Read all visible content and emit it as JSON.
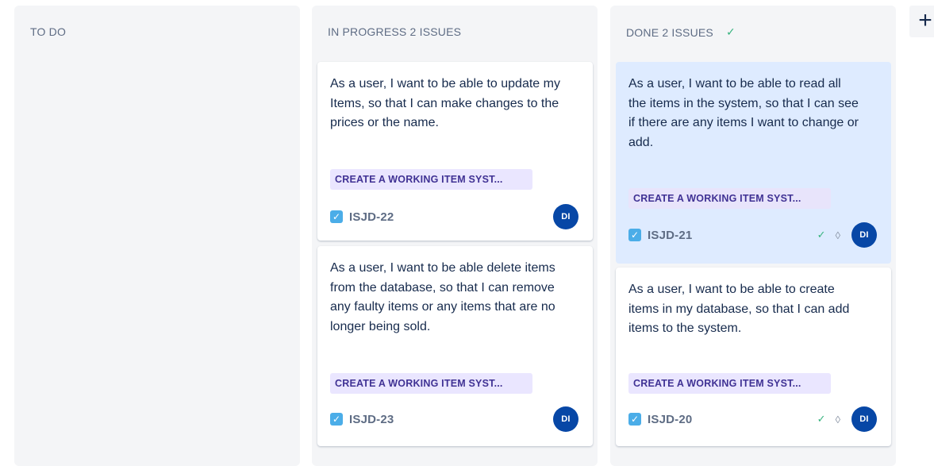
{
  "columns": {
    "todo": {
      "title": "TO DO"
    },
    "in_progress": {
      "title": "IN PROGRESS 2 ISSUES"
    },
    "done": {
      "title": "DONE 2 ISSUES"
    }
  },
  "cards": {
    "isjd22": {
      "title": "As a user, I want to be able to update my Items, so that I can make changes to the prices or the name.",
      "epic": "CREATE A WORKING ITEM SYST...",
      "key": "ISJD-22",
      "assignee": "DI"
    },
    "isjd23": {
      "title": "As a user, I want to be able delete items from the database, so that I can remove any faulty items or any items that are no longer being sold.",
      "epic": "CREATE A WORKING ITEM SYST...",
      "key": "ISJD-23",
      "assignee": "DI"
    },
    "isjd21": {
      "title": "As a user, I want to be able to read all the items in the system, so that I can see if there are any items I want to change or add.",
      "epic": "CREATE A WORKING ITEM SYST...",
      "key": "ISJD-21",
      "assignee": "DI"
    },
    "isjd20": {
      "title": "As a user, I want to be able to create items in my database, so that I can add items to the system.",
      "epic": "CREATE A WORKING ITEM SYST...",
      "key": "ISJD-20",
      "assignee": "DI"
    }
  },
  "icons": {
    "done_check": "check-icon",
    "checkbox": "checkbox-icon",
    "story_points": "story-point-icon",
    "add_column": "plus-icon"
  },
  "colors": {
    "column_bg": "#f4f5f7",
    "selected_card_bg": "#deebff",
    "epic_bg": "#eae6ff",
    "epic_text": "#403294",
    "avatar_bg": "#0747a6",
    "done_green": "#36b37e"
  }
}
